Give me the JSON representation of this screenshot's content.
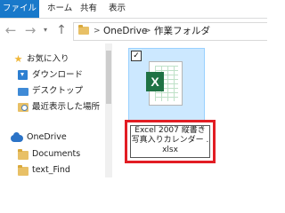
{
  "ribbon": {
    "tabs": [
      {
        "label": "ファイル"
      },
      {
        "label": "ホーム"
      },
      {
        "label": "共有"
      },
      {
        "label": "表示"
      }
    ]
  },
  "address_bar": {
    "back_glyph": "←",
    "forward_glyph": "→",
    "dropdown_glyph": "▾",
    "up_glyph": "↑",
    "separator": ">",
    "crumbs": [
      "OneDrive",
      "作業フォルダ"
    ]
  },
  "nav_pane": {
    "items": [
      {
        "label": "お気に入り",
        "icon": "star-icon"
      },
      {
        "label": "ダウンロード",
        "icon": "download-icon"
      },
      {
        "label": "デスクトップ",
        "icon": "desktop-icon"
      },
      {
        "label": "最近表示した場所",
        "icon": "recent-places-icon"
      },
      {
        "label": "OneDrive",
        "icon": "cloud-icon"
      },
      {
        "label": "Documents",
        "icon": "folder-icon"
      },
      {
        "label": "text_Find",
        "icon": "folder-icon"
      }
    ]
  },
  "content": {
    "file": {
      "checked_glyph": "✓",
      "badge": "X",
      "name": "Excel 2007 縦書き 写真入りカレンダー .xlsx"
    }
  },
  "colors": {
    "accent": "#1979ca",
    "selection_bg": "#cce8ff",
    "highlight_border": "#e21d24",
    "excel_green": "#1f7244"
  }
}
